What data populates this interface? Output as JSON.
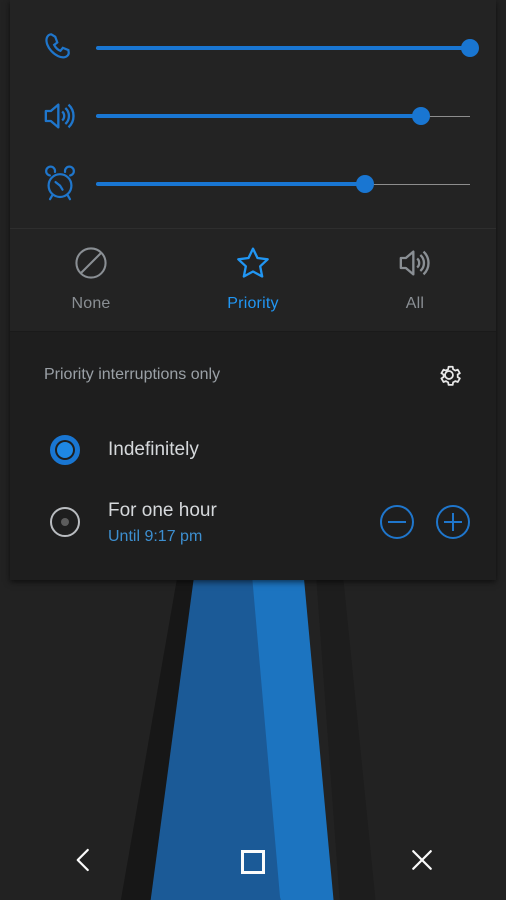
{
  "volume_sliders": [
    {
      "icon": "phone-icon",
      "name": "ring-volume-slider",
      "value": 100
    },
    {
      "icon": "speaker-icon",
      "name": "media-volume-slider",
      "value": 87
    },
    {
      "icon": "alarm-clock-icon",
      "name": "alarm-volume-slider",
      "value": 72
    }
  ],
  "modes": [
    {
      "label": "None",
      "icon": "block-icon",
      "active": false
    },
    {
      "label": "Priority",
      "icon": "star-icon",
      "active": true
    },
    {
      "label": "All",
      "icon": "speaker-icon",
      "active": false
    }
  ],
  "detail": {
    "title": "Priority interruptions only",
    "settings_icon": "gear-icon",
    "options": [
      {
        "title": "Indefinitely",
        "subtitle": "",
        "selected": true,
        "has_steppers": false
      },
      {
        "title": "For one hour",
        "subtitle": "Until 9:17 pm",
        "selected": false,
        "has_steppers": true
      }
    ],
    "stepper": {
      "minus_label": "−",
      "plus_label": "+"
    }
  },
  "navbar": [
    {
      "name": "nav-back-button",
      "icon": "chevron-left-icon"
    },
    {
      "name": "nav-home-button",
      "icon": "square-icon"
    },
    {
      "name": "nav-close-button",
      "icon": "close-icon"
    }
  ],
  "colors": {
    "accent": "#1976d2",
    "panel_bg": "#232323",
    "detail_bg": "#1e1e1e",
    "wallpaper_bg": "#222222",
    "wallpaper_blue_dark": "#1b5a97",
    "wallpaper_blue_light": "#1c74c0",
    "text_primary": "#d6d9dc",
    "text_secondary": "#9aa0a6",
    "link_blue": "#3d8fd0"
  }
}
